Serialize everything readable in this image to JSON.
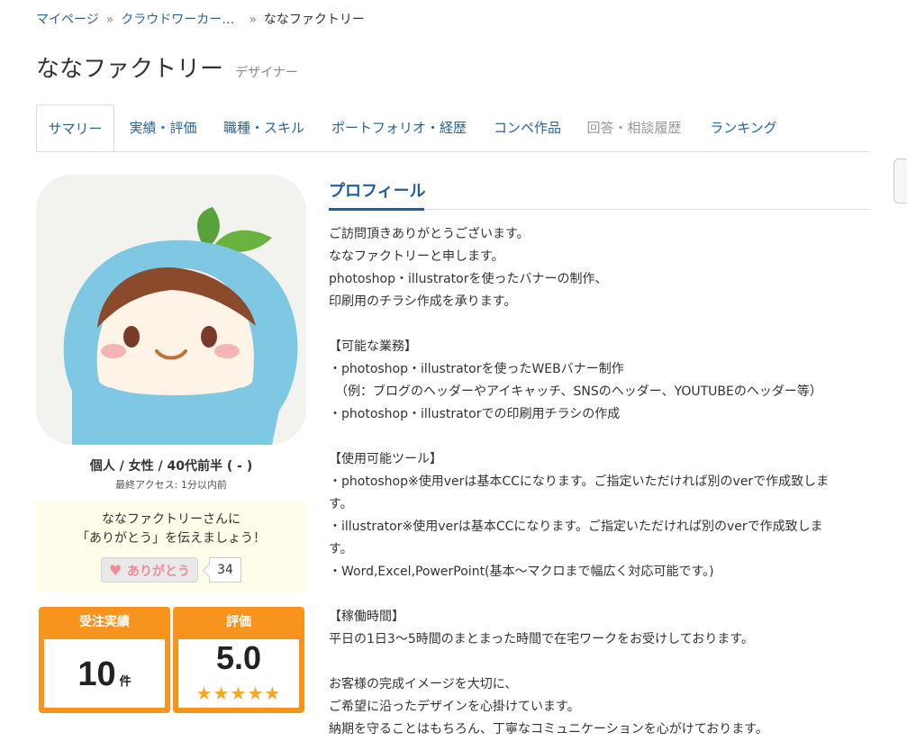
{
  "breadcrumb": {
    "items": [
      "マイページ",
      "クラウドワーカー…",
      "ななファクトリー"
    ],
    "separator": "»"
  },
  "header": {
    "title": "ななファクトリー",
    "role": "デザイナー"
  },
  "tabs": [
    {
      "label": "サマリー",
      "active": true
    },
    {
      "label": "実績・評価"
    },
    {
      "label": "職種・スキル"
    },
    {
      "label": "ポートフォリオ・経歴"
    },
    {
      "label": "コンペ作品"
    },
    {
      "label": "回答・相談履歴",
      "muted": true
    },
    {
      "label": "ランキング"
    }
  ],
  "sidebar": {
    "demographics": "個人 / 女性 / 40代前半 ( - )",
    "last_access": "最終アクセス: 1分以内前",
    "thanks": {
      "line1": "ななファクトリーさんに",
      "line2": "「ありがとう」を伝えましょう！",
      "button": "ありがとう",
      "count": "34"
    },
    "stats": {
      "orders_label": "受注実績",
      "orders_value": "10",
      "orders_unit": "件",
      "rating_label": "評価",
      "rating_value": "5.0",
      "rating_stars": 5,
      "star_color": "#f5a623"
    }
  },
  "profile": {
    "title": "プロフィール",
    "lines": [
      "ご訪問頂きありがとうございます。",
      "ななファクトリーと申します。",
      "photoshop・illustratorを使ったバナーの制作、",
      "印刷用のチラシ作成を承ります。",
      "",
      "【可能な業務】",
      "・photoshop・illustratorを使ったWEBバナー制作",
      "　（例：ブログのヘッダーやアイキャッチ、SNSのヘッダー、YOUTUBEのヘッダー等）",
      "・photoshop・illustratorでの印刷用チラシの作成",
      "",
      "【使用可能ツール】",
      "・photoshop※使用verは基本CCになります。ご指定いただければ別のverで作成致しま",
      "す。",
      "・illustrator※使用verは基本CCになります。ご指定いただければ別のverで作成致しま",
      "す。",
      "・Word,Excel,PowerPoint(基本～マクロまで幅広く対応可能です。)",
      "",
      "【稼働時間】",
      "平日の1日3～5時間のまとまった時間で在宅ワークをお受けしております。",
      "",
      "お客様の完成イメージを大切に、",
      "ご希望に沿ったデザインを心掛けています。",
      "納期を守ることはもちろん、丁寧なコミュニケーションを心がけております。"
    ]
  },
  "colors": {
    "link": "#2a6496",
    "accent_blue": "#1f5e9c",
    "stat_orange": "#f7941d",
    "thanks_bg": "#fffde9",
    "heart_pink": "#f08a96"
  }
}
